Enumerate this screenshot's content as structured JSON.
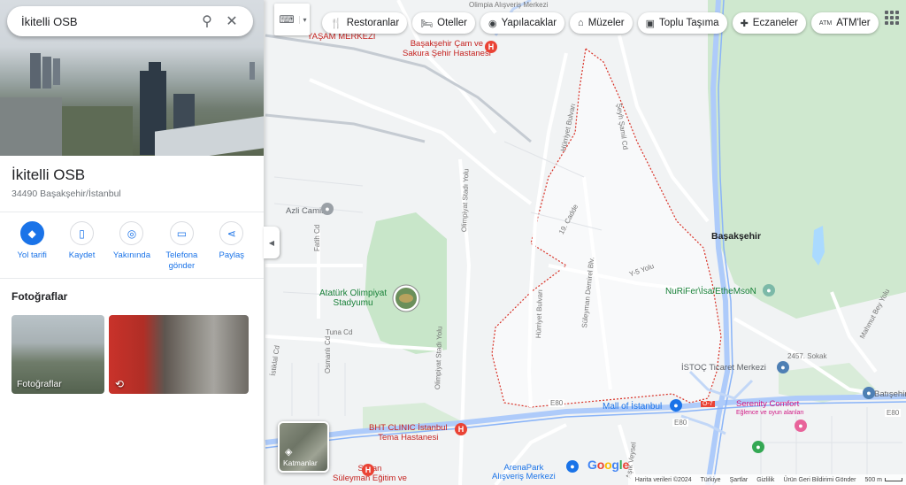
{
  "search": {
    "value": "İkitelli OSB"
  },
  "place": {
    "title": "İkitelli OSB",
    "address": "34490 Başakşehir/İstanbul"
  },
  "actions": [
    {
      "label": "Yol tarifi",
      "icon": "directions-icon"
    },
    {
      "label": "Kaydet",
      "icon": "bookmark-icon"
    },
    {
      "label": "Yakınında",
      "icon": "nearby-icon"
    },
    {
      "label": "Telefona gönder",
      "icon": "send-to-phone-icon"
    },
    {
      "label": "Paylaş",
      "icon": "share-icon"
    }
  ],
  "photos": {
    "heading": "Fotoğraflar",
    "items": [
      {
        "caption": "Fotoğraflar"
      },
      {
        "caption": ""
      }
    ]
  },
  "chips": [
    {
      "label": "Restoranlar",
      "icon": "restaurant-icon"
    },
    {
      "label": "Oteller",
      "icon": "hotel-icon"
    },
    {
      "label": "Yapılacaklar",
      "icon": "camera-icon"
    },
    {
      "label": "Müzeler",
      "icon": "museum-icon"
    },
    {
      "label": "Toplu Taşıma",
      "icon": "transit-icon"
    },
    {
      "label": "Eczaneler",
      "icon": "pharmacy-icon"
    },
    {
      "label": "ATM'ler",
      "icon": "atm-icon"
    }
  ],
  "layers": {
    "label": "Katmanlar"
  },
  "map_labels": {
    "yasam_merkezi": "YAŞAM MERKEZİ",
    "olimpia": "Olimpia Alışveriş Merkezi",
    "hospital": "Başakşehir Çam ve Sakura Şehir Hastanesi",
    "hospital_l2": "Sakura Şehir Hastanesi",
    "hospital_l1": "Başakşehir Çam ve",
    "seyh_samil": "Şeyh Şamil Cd",
    "hurriyet1": "Hürriyet Bulvarı",
    "hurriyet2": "Hürriyet Bulvarı",
    "olimpiyat_yolu1": "Olimpiyat Stadı Yolu",
    "olimpiyat_yolu2": "Olimpiyat Stadı Yolu",
    "cadde19": "19. Cadde",
    "demirel": "Süleyman Demirel Blv.",
    "yolu5": "Y-5 Yolu",
    "basaksehir": "Başakşehir",
    "nurifer": "NuRiFer\\İsa/EtheMsoN",
    "cami": "Azli Camii",
    "fatih": "Fatih Cd",
    "ataturk_l1": "Atatürk Olimpiyat",
    "ataturk_l2": "Stadyumu",
    "tuna": "Tuna Cd",
    "osmanli": "Osmanlı Cd",
    "istiklal": "İstiklal Cd",
    "mahmutbey": "Mahmut Bey Yolu",
    "sokak": "2457. Sokak",
    "istoc": "İSTOÇ Ticaret Merkezi",
    "batisehir": "Batışehir",
    "mall": "Mall of İstanbul",
    "serenity_l1": "Serenity Comfort",
    "serenity_l2": "Eğlence ve oyun alanları",
    "e80a": "E80",
    "e80b": "E80",
    "e80c": "E80",
    "o7": "O-7",
    "bht_l1": "BHT CLINIC İstanbul",
    "bht_l2": "Tema Hastanesi",
    "sultan_l1": "Sultan",
    "sultan_l2": "Süleyman Eğitim ve",
    "arenapark_l1": "ArenaPark",
    "arenapark_l2": "Alışveriş Merkezi",
    "asik_veysel": "Aşık Veysel"
  },
  "footer": {
    "map_data": "Harita verileri ©2024",
    "country": "Türkiye",
    "terms": "Şartlar",
    "privacy": "Gizlilik",
    "feedback": "Ürün Geri Bildirimi Gönder",
    "scale": "500 m"
  },
  "google_logo": "Google",
  "colors": {
    "accent": "#1a73e8",
    "boundary": "#d93025",
    "park": "#c8e6c9",
    "highway": "#aecbfa"
  }
}
